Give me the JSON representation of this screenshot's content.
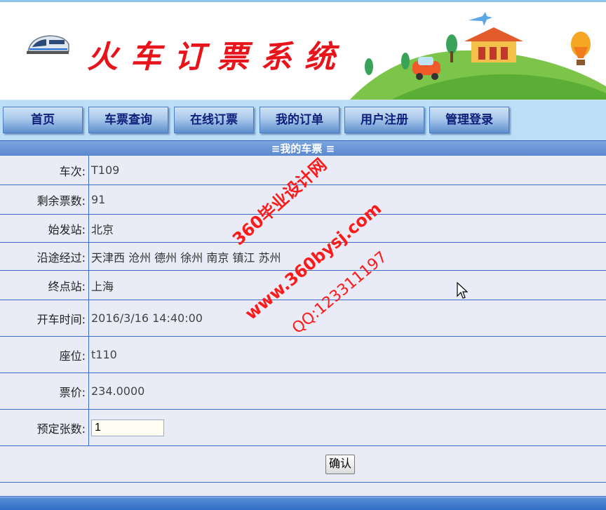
{
  "header": {
    "title": "火车订票系统"
  },
  "nav": {
    "items": [
      {
        "label": "首页"
      },
      {
        "label": "车票查询"
      },
      {
        "label": "在线订票"
      },
      {
        "label": "我的订单"
      },
      {
        "label": "用户注册"
      },
      {
        "label": "管理登录"
      }
    ]
  },
  "section": {
    "title": "≡我的车票 ≡"
  },
  "ticket": {
    "rows": [
      {
        "label": "车次:",
        "value": "T109"
      },
      {
        "label": "剩余票数:",
        "value": "91"
      },
      {
        "label": "始发站:",
        "value": "北京"
      },
      {
        "label": "沿途经过:",
        "value": "天津西 沧州 德州 徐州 南京 镇江 苏州"
      },
      {
        "label": "终点站:",
        "value": "上海"
      },
      {
        "label": "开车时间:",
        "value": "2016/3/16 14:40:00"
      },
      {
        "label": "座位:",
        "value": "t110"
      },
      {
        "label": "票价:",
        "value": "234.0000"
      }
    ],
    "quantity_label": "预定张数:",
    "quantity_value": "1",
    "confirm_label": "确认"
  },
  "watermark": {
    "line1": "360毕业设计网",
    "line2": "www.360bysj.com",
    "line3": "QQ:123311197"
  },
  "colors": {
    "title_red": "#e8141b",
    "nav_text": "#0d1e7a",
    "row_bg": "#e9ecf7",
    "grid_blue": "#3d6cc6"
  }
}
